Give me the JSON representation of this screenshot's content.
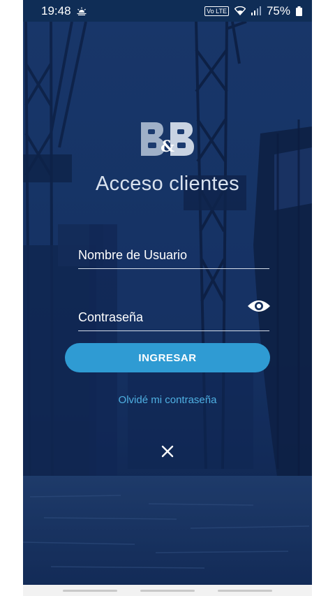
{
  "status_bar": {
    "time": "19:48",
    "battery": "75%",
    "network_badge": "Vo LTE",
    "icons": [
      "sunrise-icon",
      "volte-icon",
      "wifi-icon",
      "signal-icon",
      "battery-icon"
    ]
  },
  "logo": {
    "text": "B&B"
  },
  "login": {
    "title": "Acceso clientes",
    "username_label": "Nombre de Usuario",
    "password_label": "Contraseña",
    "submit_label": "INGRESAR",
    "forgot_link": "Olvidé mi contraseña"
  },
  "colors": {
    "status_bar": "#0f2d56",
    "background": "#16305c",
    "button": "#2f9bd3",
    "link": "#4fb0e3",
    "field_line": "#d5dde9"
  }
}
